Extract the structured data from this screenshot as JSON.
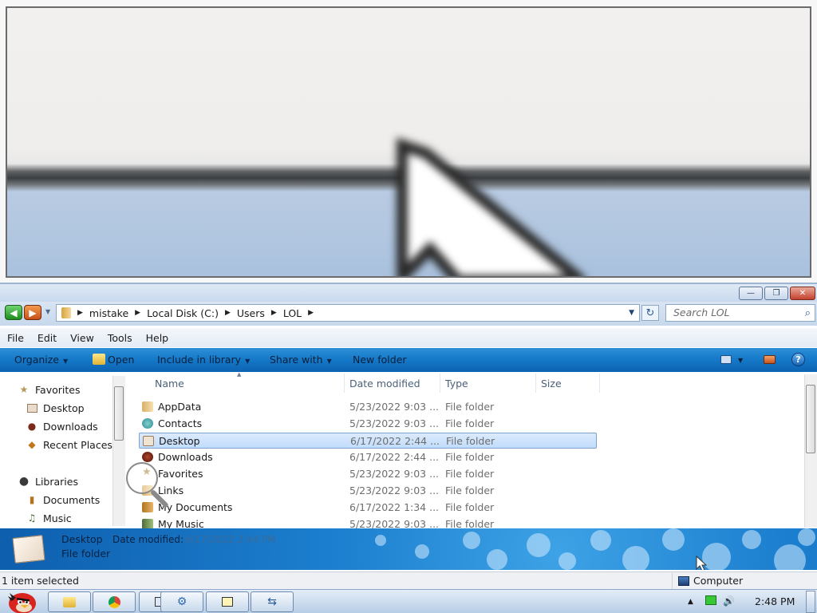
{
  "window": {
    "minimize_glyph": "—",
    "restore_glyph": "❐",
    "close_glyph": "✕"
  },
  "address": {
    "crumbs": [
      "mistake",
      "Local Disk (C:)",
      "Users",
      "LOL"
    ],
    "search_placeholder": "Search LOL"
  },
  "menu": [
    "File",
    "Edit",
    "View",
    "Tools",
    "Help"
  ],
  "commands": {
    "organize": "Organize",
    "open": "Open",
    "include": "Include in library",
    "share": "Share with",
    "new_folder": "New folder"
  },
  "nav": {
    "favorites": "Favorites",
    "desktop": "Desktop",
    "downloads": "Downloads",
    "recent": "Recent Places",
    "libraries": "Libraries",
    "documents": "Documents",
    "music": "Music"
  },
  "columns": {
    "name": "Name",
    "date": "Date modified",
    "type": "Type",
    "size": "Size"
  },
  "files": [
    {
      "name": "AppData",
      "date": "5/23/2022 9:03 ...",
      "type": "File folder"
    },
    {
      "name": "Contacts",
      "date": "5/23/2022 9:03 ...",
      "type": "File folder"
    },
    {
      "name": "Desktop",
      "date": "6/17/2022 2:44 ...",
      "type": "File folder"
    },
    {
      "name": "Downloads",
      "date": "6/17/2022 2:44 ...",
      "type": "File folder"
    },
    {
      "name": "Favorites",
      "date": "5/23/2022 9:03 ...",
      "type": "File folder"
    },
    {
      "name": "Links",
      "date": "5/23/2022 9:03 ...",
      "type": "File folder"
    },
    {
      "name": "My Documents",
      "date": "6/17/2022 1:34 ...",
      "type": "File folder"
    },
    {
      "name": "My Music",
      "date": "5/23/2022 9:03 ...",
      "type": "File folder"
    }
  ],
  "details": {
    "name": "Desktop",
    "type": "File folder",
    "label": "Date modified:",
    "value": "6/17/2022 2:44 PM"
  },
  "status": {
    "left": "1 item selected",
    "right": "Computer"
  },
  "clock": "2:48 PM"
}
